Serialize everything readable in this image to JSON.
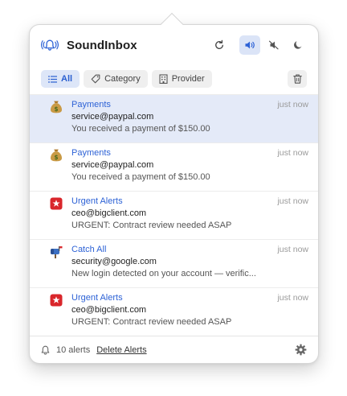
{
  "app": {
    "title": "SoundInbox"
  },
  "header": {
    "icons": [
      "refresh-icon",
      "speaker-on-icon",
      "speaker-mute-icon",
      "moon-icon"
    ],
    "active": "speaker-on-icon",
    "accent": "#2d62d6"
  },
  "filters": {
    "all": "All",
    "category": "Category",
    "provider": "Provider",
    "active": "All"
  },
  "alerts": [
    {
      "emoji": "money-bag-icon",
      "category": "Payments",
      "from": "service@paypal.com",
      "message": "You received a payment of $150.00",
      "time": "just now",
      "selected": true
    },
    {
      "emoji": "money-bag-icon",
      "category": "Payments",
      "from": "service@paypal.com",
      "message": "You received a payment of $150.00",
      "time": "just now",
      "selected": false
    },
    {
      "emoji": "siren-icon",
      "category": "Urgent Alerts",
      "from": "ceo@bigclient.com",
      "message": "URGENT: Contract review needed ASAP",
      "time": "just now",
      "selected": false
    },
    {
      "emoji": "mailbox-icon",
      "category": "Catch All",
      "from": "security@google.com",
      "message": "New login detected on your account — verific...",
      "time": "just now",
      "selected": false
    },
    {
      "emoji": "siren-icon",
      "category": "Urgent Alerts",
      "from": "ceo@bigclient.com",
      "message": "URGENT: Contract review needed ASAP",
      "time": "just now",
      "selected": false
    }
  ],
  "footer": {
    "count": "10 alerts",
    "delete_label": "Delete Alerts"
  }
}
